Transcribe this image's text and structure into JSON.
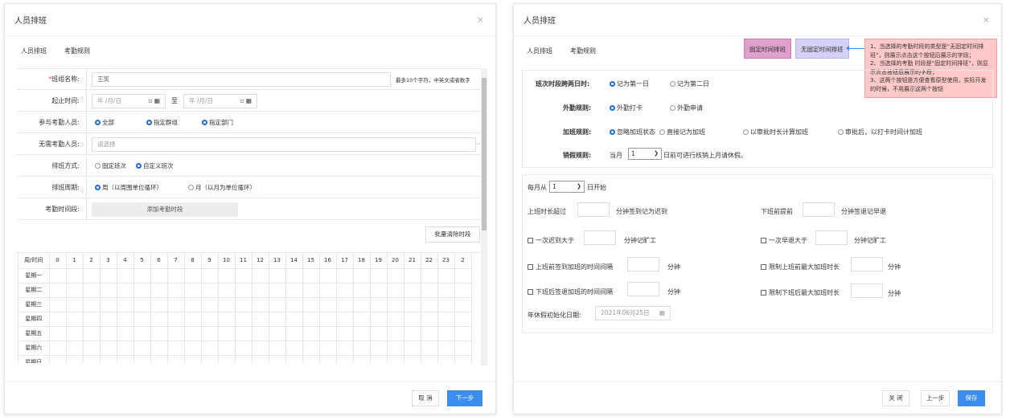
{
  "left": {
    "title": "人员排班",
    "close": "×",
    "tabs": [
      "人员排班",
      "考勤规则"
    ],
    "rows": {
      "name": {
        "req": "*",
        "label": "班组名称:",
        "value": "王笑",
        "hint": "最多10个字符，中英文或者数字"
      },
      "period": {
        "label": "起止时间:",
        "start": "年 /月/日",
        "sep": "至",
        "end": "年 /月/日"
      },
      "participants": {
        "label": "参与考勤人员:",
        "opts": [
          "全部",
          "指定群组",
          "指定部门"
        ]
      },
      "exempt": {
        "label": "无需考勤人员:",
        "placeholder": "请选择",
        "more": "···"
      },
      "method": {
        "label": "排班方式:",
        "opts": [
          "固定班次",
          "自定义班次"
        ]
      },
      "cycle": {
        "label": "排班周期:",
        "opts": [
          "周（以周围单位循环）",
          "月（以月为单位循环）"
        ]
      },
      "slot": {
        "label": "考勤时间段:",
        "button": "添加考勤时段"
      }
    },
    "batch_clear": "批量清除时段",
    "grid": {
      "corner": "周/时间",
      "hours": [
        "0",
        "1",
        "2",
        "3",
        "4",
        "5",
        "6",
        "7",
        "8",
        "9",
        "10",
        "11",
        "12",
        "13",
        "14",
        "15",
        "16",
        "17",
        "18",
        "19",
        "20",
        "21",
        "22",
        "23",
        "2"
      ],
      "days": [
        "星期一",
        "星期二",
        "星期三",
        "星期四",
        "星期五",
        "星期六",
        "星期日"
      ]
    },
    "footer": {
      "cancel": "取 消",
      "next": "下一步"
    }
  },
  "right": {
    "title": "人员排班",
    "close": "×",
    "tabs": [
      "人员排班",
      "考勤规则"
    ],
    "tag_fixed": "固定时间排班",
    "tag_free": "无固定时间排班",
    "note": [
      "1、当选择的考勤时段的类型是“无固定时间排班”，则展示点击这个按钮后展示的字段；",
      "2、当选择的考勤 时段是“固定时间排班”，则显示点击按钮后展示的字段；",
      "3、这两个按钮是方便查看原型使用，实际开发的时候，不用展示这两个按钮"
    ],
    "rules": {
      "cross": {
        "label": "班次时段跨两日时:",
        "opts": [
          "记为第一日",
          "记为第二日"
        ]
      },
      "out": {
        "label": "外勤规则:",
        "opts": [
          "外勤打卡",
          "外勤申请"
        ]
      },
      "ot": {
        "label": "加班规则:",
        "opts": [
          "忽略加班状态",
          "直接记为加班",
          "以审批时长计算加班",
          "审批后，以打卡时间计加班"
        ]
      },
      "leave": {
        "label": "销假规则:",
        "pre": "当月",
        "value": "1",
        "post": "日前可进行核销上月请休假。"
      }
    },
    "month": {
      "pre": "每月从",
      "value": "1",
      "post": "日开始"
    },
    "late": {
      "label": "上班时长超过",
      "unit": "分钟签到记为迟到"
    },
    "early": {
      "label": "下班前提前",
      "unit": "分钟签退记早退"
    },
    "late_abs": {
      "label": "一次迟到大于",
      "unit": "分钟记旷工"
    },
    "early_abs": {
      "label": "一次早退大于",
      "unit": "分钟记旷工"
    },
    "before_gap": {
      "label": "上班前签到加班的时间间隔",
      "unit": "分钟"
    },
    "before_max": {
      "label": "限制上班前最大加班时长",
      "unit": "分钟"
    },
    "after_gap": {
      "label": "下班后签退加班的时间间隔",
      "unit": "分钟"
    },
    "after_max": {
      "label": "限制下班后最大加班时长",
      "unit": "分钟"
    },
    "annual": {
      "label": "年休假初始化日期:",
      "value": "2021年06月25日"
    },
    "footer": {
      "close": "关 闭",
      "prev": "上一步",
      "save": "保存"
    }
  }
}
